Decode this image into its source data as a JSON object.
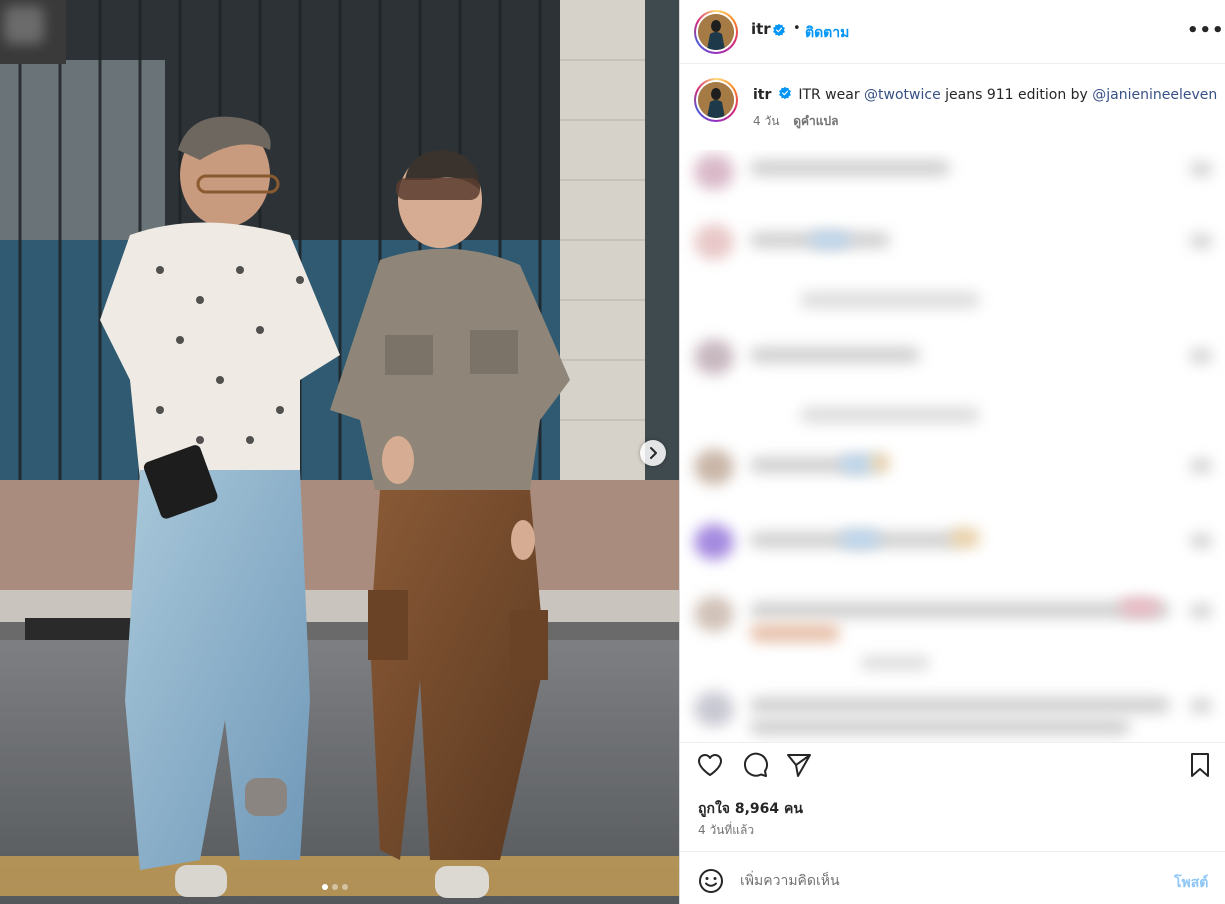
{
  "post": {
    "username": "itr",
    "separator": "•",
    "follow_label": "ติดตาม",
    "more_label": "•••",
    "verified_color": "#0095f6",
    "link_color": "#385185"
  },
  "caption": {
    "username": "itr",
    "text_before": "ITR wear ",
    "mention_1": "@twotwice",
    "text_middle": " jeans 911 edition by ",
    "mention_2": "@janienineeleven",
    "age": "4 วัน",
    "translate_label": "ดูคำแปล"
  },
  "comments": {
    "state": "blurred"
  },
  "stats": {
    "likes_text": "ถูกใจ 8,964 คน",
    "time_text": "4 วันที่แล้ว"
  },
  "composer": {
    "placeholder": "เพิ่มความคิดเห็น",
    "post_label": "โพสต์"
  },
  "carousel": {
    "slide_count": 3,
    "current_index": 0
  },
  "icons": {
    "like": "heart-icon",
    "comment": "comment-icon",
    "share": "share-icon",
    "save": "bookmark-icon",
    "emoji": "emoji-icon",
    "next": "chevron-right-icon",
    "verified": "verified-badge-icon"
  }
}
